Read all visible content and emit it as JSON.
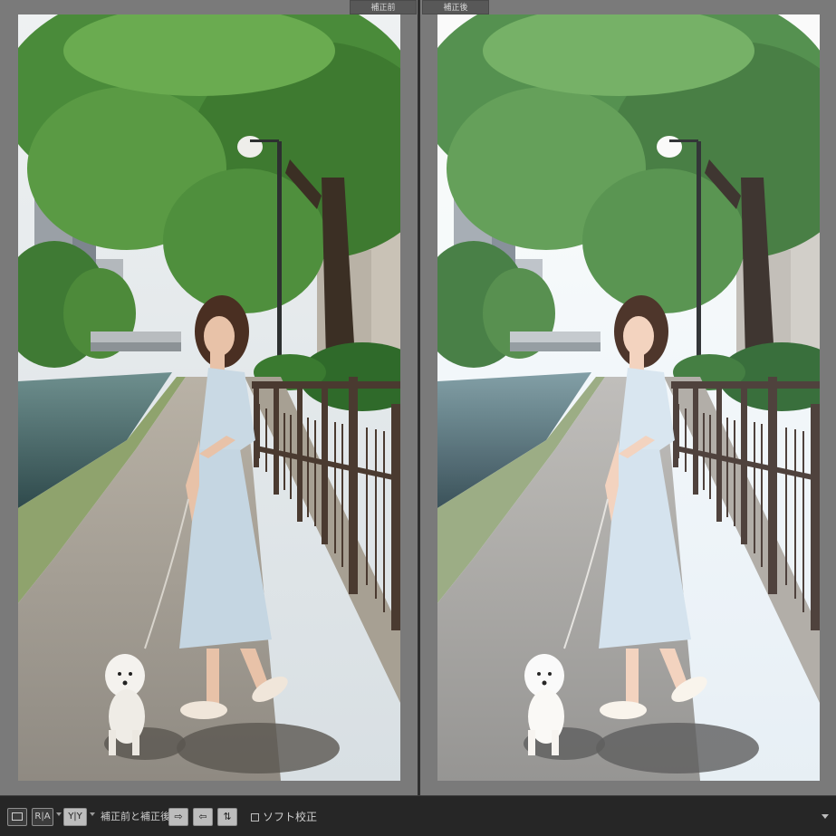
{
  "compare": {
    "before_label": "補正前",
    "after_label": "補正後"
  },
  "toolbar": {
    "view_loupe": "",
    "view_ab": "R|A",
    "view_yy": "Y|Y",
    "copy_label": "補正前と補正後 :",
    "soft_proof_label": "ソフト校正"
  },
  "icons": {
    "loupe": "single-view-icon",
    "before_after_split": "before-after-split-icon",
    "before_after_yy": "before-after-yy-icon",
    "copy_before_to_after": "copy-before-to-after-icon",
    "copy_after_to_before": "copy-after-to-before-icon",
    "swap": "swap-icon",
    "toolbar_menu": "toolbar-menu-icon"
  }
}
